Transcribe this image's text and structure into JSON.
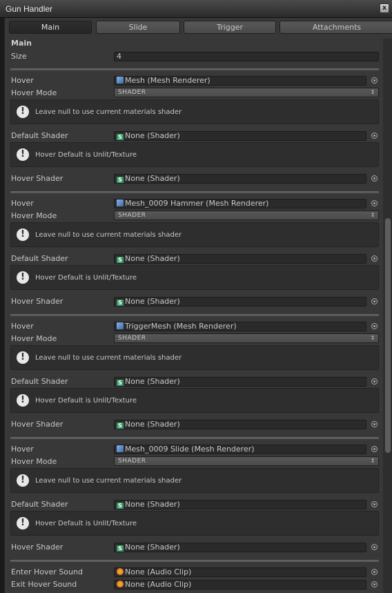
{
  "window": {
    "title": "Gun Handler",
    "close_glyph": "x"
  },
  "tabs": [
    {
      "label": "Main",
      "active": true
    },
    {
      "label": "Slide",
      "active": false
    },
    {
      "label": "Trigger",
      "active": false
    },
    {
      "label": "Attachments",
      "active": false
    }
  ],
  "main": {
    "section_title": "Main",
    "size_label": "Size",
    "size_value": "4",
    "entries": [
      {
        "hover_label": "Hover",
        "hover_value": "Mesh (Mesh Renderer)",
        "mode_label": "Hover Mode",
        "mode_value": "SHADER",
        "help1": "Leave null to use current materials shader",
        "default_label": "Default Shader",
        "default_value": "None (Shader)",
        "help2": "Hover Default is Unlit/Texture",
        "hover_shader_label": "Hover Shader",
        "hover_shader_value": "None (Shader)"
      },
      {
        "hover_label": "Hover",
        "hover_value": "Mesh_0009 Hammer (Mesh Renderer)",
        "mode_label": "Hover Mode",
        "mode_value": "SHADER",
        "help1": "Leave null to use current materials shader",
        "default_label": "Default Shader",
        "default_value": "None (Shader)",
        "help2": "Hover Default is Unlit/Texture",
        "hover_shader_label": "Hover Shader",
        "hover_shader_value": "None (Shader)"
      },
      {
        "hover_label": "Hover",
        "hover_value": "TriggerMesh (Mesh Renderer)",
        "mode_label": "Hover Mode",
        "mode_value": "SHADER",
        "help1": "Leave null to use current materials shader",
        "default_label": "Default Shader",
        "default_value": "None (Shader)",
        "help2": "Hover Default is Unlit/Texture",
        "hover_shader_label": "Hover Shader",
        "hover_shader_value": "None (Shader)"
      },
      {
        "hover_label": "Hover",
        "hover_value": "Mesh_0009 Slide (Mesh Renderer)",
        "mode_label": "Hover Mode",
        "mode_value": "SHADER",
        "help1": "Leave null to use current materials shader",
        "default_label": "Default Shader",
        "default_value": "None (Shader)",
        "help2": "Hover Default is Unlit/Texture",
        "hover_shader_label": "Hover Shader",
        "hover_shader_value": "None (Shader)"
      }
    ],
    "enter_sound_label": "Enter Hover Sound",
    "enter_sound_value": "None (Audio Clip)",
    "exit_sound_label": "Exit Hover Sound",
    "exit_sound_value": "None (Audio Clip)"
  },
  "icons": {
    "mesh": "mesh-renderer-icon",
    "shader": "shader-icon",
    "audio": "audio-clip-icon",
    "help": "info-icon",
    "picker": "object-picker-icon"
  }
}
